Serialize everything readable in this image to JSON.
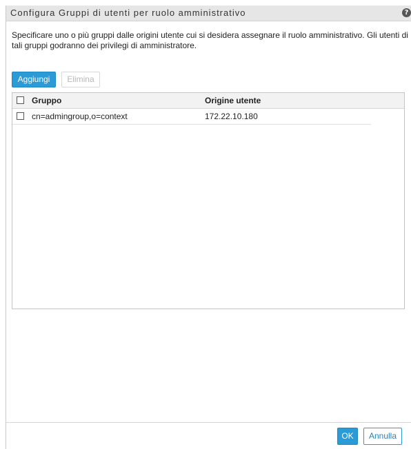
{
  "dialog": {
    "title": "Configura Gruppi di utenti per ruolo amministrativo",
    "help_icon": "question-circle-icon",
    "help_glyph": "?",
    "description": "Specificare uno o più gruppi dalle origini utente cui si desidera assegnare il ruolo amministrativo. Gli utenti di tali gruppi godranno dei privilegi di amministratore."
  },
  "toolbar": {
    "add_label": "Aggiungi",
    "delete_label": "Elimina"
  },
  "table": {
    "columns": [
      "Gruppo",
      "Origine utente"
    ],
    "rows": [
      {
        "group": "cn=admingroup,o=context",
        "source": "172.22.10.180",
        "checked": false
      }
    ]
  },
  "footer": {
    "ok_label": "OK",
    "cancel_label": "Annulla"
  },
  "colors": {
    "accent": "#2a9bd6",
    "title_bar": "#e6e6e6"
  }
}
